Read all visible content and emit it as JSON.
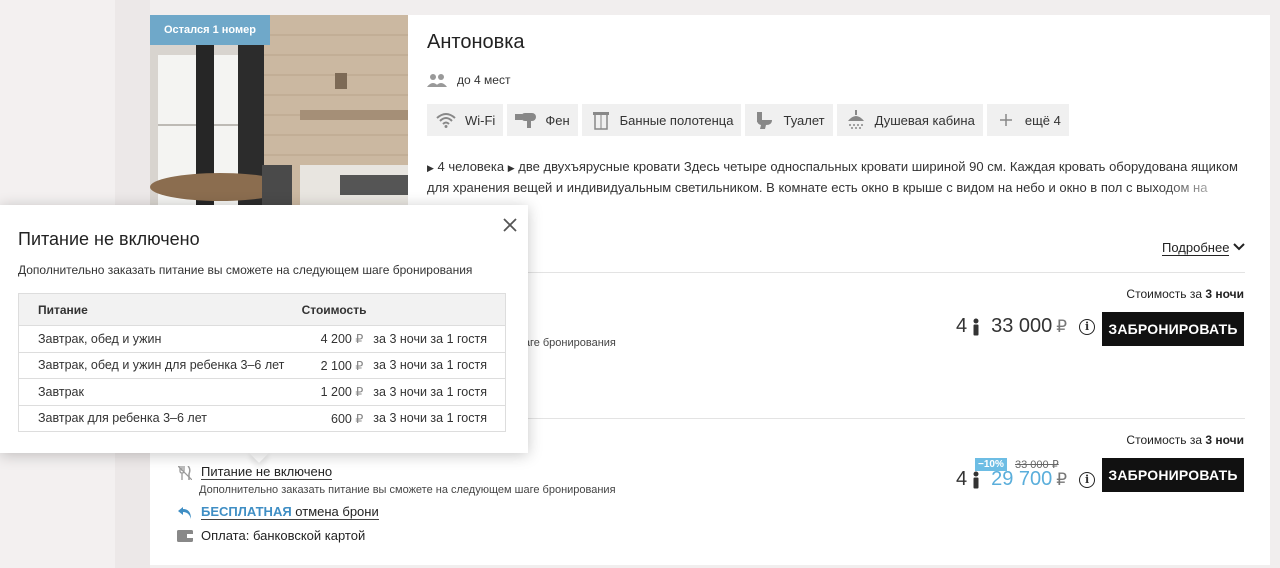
{
  "room": {
    "badge": "Остался 1 номер",
    "title": "Антоновка",
    "capacity": "до 4 мест",
    "amenities": [
      {
        "label": "Wi-Fi",
        "icon": "wifi-icon"
      },
      {
        "label": "Фен",
        "icon": "hairdryer-icon"
      },
      {
        "label": "Банные полотенца",
        "icon": "towel-icon"
      },
      {
        "label": "Туалет",
        "icon": "toilet-icon"
      },
      {
        "label": "Душевая кабина",
        "icon": "shower-icon"
      },
      {
        "label": "ещё 4",
        "icon": "plus-icon"
      }
    ],
    "description_p1": "4 человека",
    "description_p2": "две двухъярусные кровати Здесь четыре односпальных кровати шириной 90 см. Каждая кровать оборудована ящиком для хранения вещей и индивидуальным светильником. В комнате есть окно в крыше с видом на небо и окно в пол с выходом на балкончик. По",
    "more_label": "Подробнее"
  },
  "rates": [
    {
      "cost_prefix": "Стоимость за",
      "cost_nights": "3 ночи",
      "guests": "4",
      "price": "33 000",
      "currency": "₽",
      "book_label": "ЗАБРОНИРОВАТЬ",
      "partial_note": "шаге бронирования"
    },
    {
      "cost_prefix": "Стоимость за",
      "cost_nights": "3 ночи",
      "guests": "4",
      "discount": "−10%",
      "old_price": "33 000 ₽",
      "price": "29 700",
      "currency": "₽",
      "book_label": "ЗАБРОНИРОВАТЬ",
      "meal_label": "Питание не включено",
      "meal_note": "Дополнительно заказать питание вы сможете на следующем шаге бронирования",
      "cancel_free": "БЕСПЛАТНАЯ",
      "cancel_rest": "отмена брони",
      "payment": "Оплата: банковской картой"
    }
  ],
  "popover": {
    "title": "Питание не включено",
    "subtitle": "Дополнительно заказать питание вы сможете на следующем шаге бронирования",
    "columns": [
      "Питание",
      "Стоимость"
    ],
    "rows": [
      {
        "name": "Завтрак, обед и ужин",
        "price": "4 200",
        "currency": "₽",
        "per": "за 3 ночи за 1 гостя"
      },
      {
        "name": "Завтрак, обед и ужин для ребенка 3–6 лет",
        "price": "2 100",
        "currency": "₽",
        "per": "за 3 ночи за 1 гостя"
      },
      {
        "name": "Завтрак",
        "price": "1 200",
        "currency": "₽",
        "per": "за 3 ночи за 1 гостя"
      },
      {
        "name": "Завтрак для ребенка 3–6 лет",
        "price": "600",
        "currency": "₽",
        "per": "за 3 ночи за 1 гостя"
      }
    ]
  },
  "colors": {
    "badge": "#6fa8c9",
    "accent_blue": "#3f8ec4",
    "discount": "#6dbde4",
    "button": "#111111"
  }
}
